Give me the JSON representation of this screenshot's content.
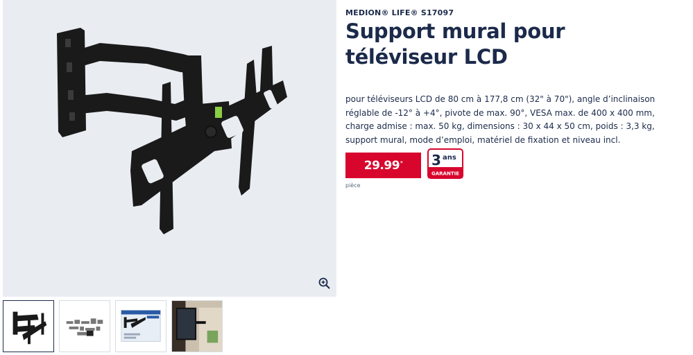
{
  "product": {
    "brand": "MEDION® LIFE® S17097",
    "title": "Support mural pour téléviseur LCD",
    "description": "pour téléviseurs LCD de 80 cm à 177,8 cm (32\" à 70\"), angle d’inclinaison réglable de -12° à +4°, pivote de max. 90°, VESA max. de 400 x 400 mm, charge admise : max. 50 kg, dimensions : 30 x 44 x 50 cm, poids : 3,3 kg, support mural, mode d’emploi, matériel de fixation et niveau incl.",
    "price": "29.99",
    "price_suffix": "*",
    "unit": "pièce",
    "warranty_number": "3",
    "warranty_unit": "ans",
    "warranty_label": "GARANTIE"
  },
  "gallery": {
    "zoom_icon": "zoom-in-icon",
    "thumbnails": [
      {
        "name": "thumbnail-wall-mount",
        "active": true
      },
      {
        "name": "thumbnail-accessories",
        "active": false
      },
      {
        "name": "thumbnail-packaging",
        "active": false
      },
      {
        "name": "thumbnail-installed",
        "active": false
      }
    ]
  },
  "colors": {
    "brand_navy": "#1b2a4a",
    "price_red": "#d8062d",
    "gallery_bg": "#e9edf2"
  }
}
